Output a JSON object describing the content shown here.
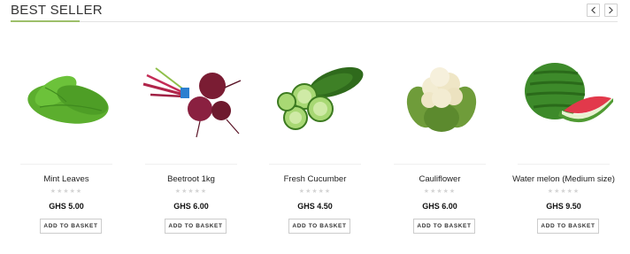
{
  "section": {
    "title": "BEST SELLER",
    "accent_color": "#9dbf6a",
    "nav": {
      "prev_icon": "chevron-left-icon",
      "next_icon": "chevron-right-icon"
    }
  },
  "products": [
    {
      "name": "Mint Leaves",
      "price": "GHS 5.00",
      "rating": 0,
      "button": "ADD TO BASKET",
      "image": "mint-leaves-image"
    },
    {
      "name": "Beetroot 1kg",
      "price": "GHS 6.00",
      "rating": 0,
      "button": "ADD TO BASKET",
      "image": "beetroot-image"
    },
    {
      "name": "Fresh Cucumber",
      "price": "GHS 4.50",
      "rating": 0,
      "button": "ADD TO BASKET",
      "image": "cucumber-image"
    },
    {
      "name": "Cauliflower",
      "price": "GHS 6.00",
      "rating": 0,
      "button": "ADD TO BASKET",
      "image": "cauliflower-image"
    },
    {
      "name": "Water melon (Medium size)",
      "price": "GHS 9.50",
      "rating": 0,
      "button": "ADD TO BASKET",
      "image": "watermelon-image"
    }
  ]
}
